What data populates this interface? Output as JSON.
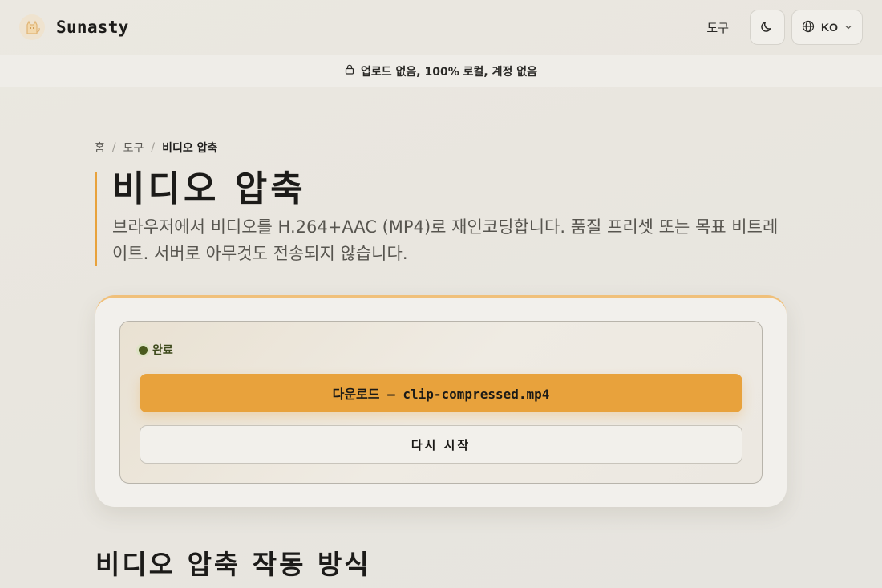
{
  "header": {
    "brand_name": "Sunasty",
    "nav_tools": "도구",
    "language": "KO"
  },
  "banner": {
    "text": "업로드 없음, 100% 로컬, 계정 없음"
  },
  "breadcrumb": {
    "home": "홈",
    "tools": "도구",
    "current": "비디오 압축"
  },
  "page": {
    "title": "비디오 압축",
    "description": "브라우저에서 비디오를 H.264+AAC (MP4)로 재인코딩합니다. 품질 프리셋 또는 목표 비트레이트. 서버로 아무것도 전송되지 않습니다."
  },
  "result": {
    "status": "완료",
    "download_label": "다운로드 — clip-compressed.mp4",
    "restart_label": "다시 시작"
  },
  "section": {
    "title": "비디오 압축 작동 방식"
  },
  "colors": {
    "accent": "#e8a23c",
    "status_dot": "#4a5a1e"
  },
  "icons": {
    "logo": "cat-logo-icon",
    "theme": "moon-icon",
    "language": "globe-icon",
    "dropdown": "chevron-down-icon",
    "banner": "lock-icon"
  }
}
